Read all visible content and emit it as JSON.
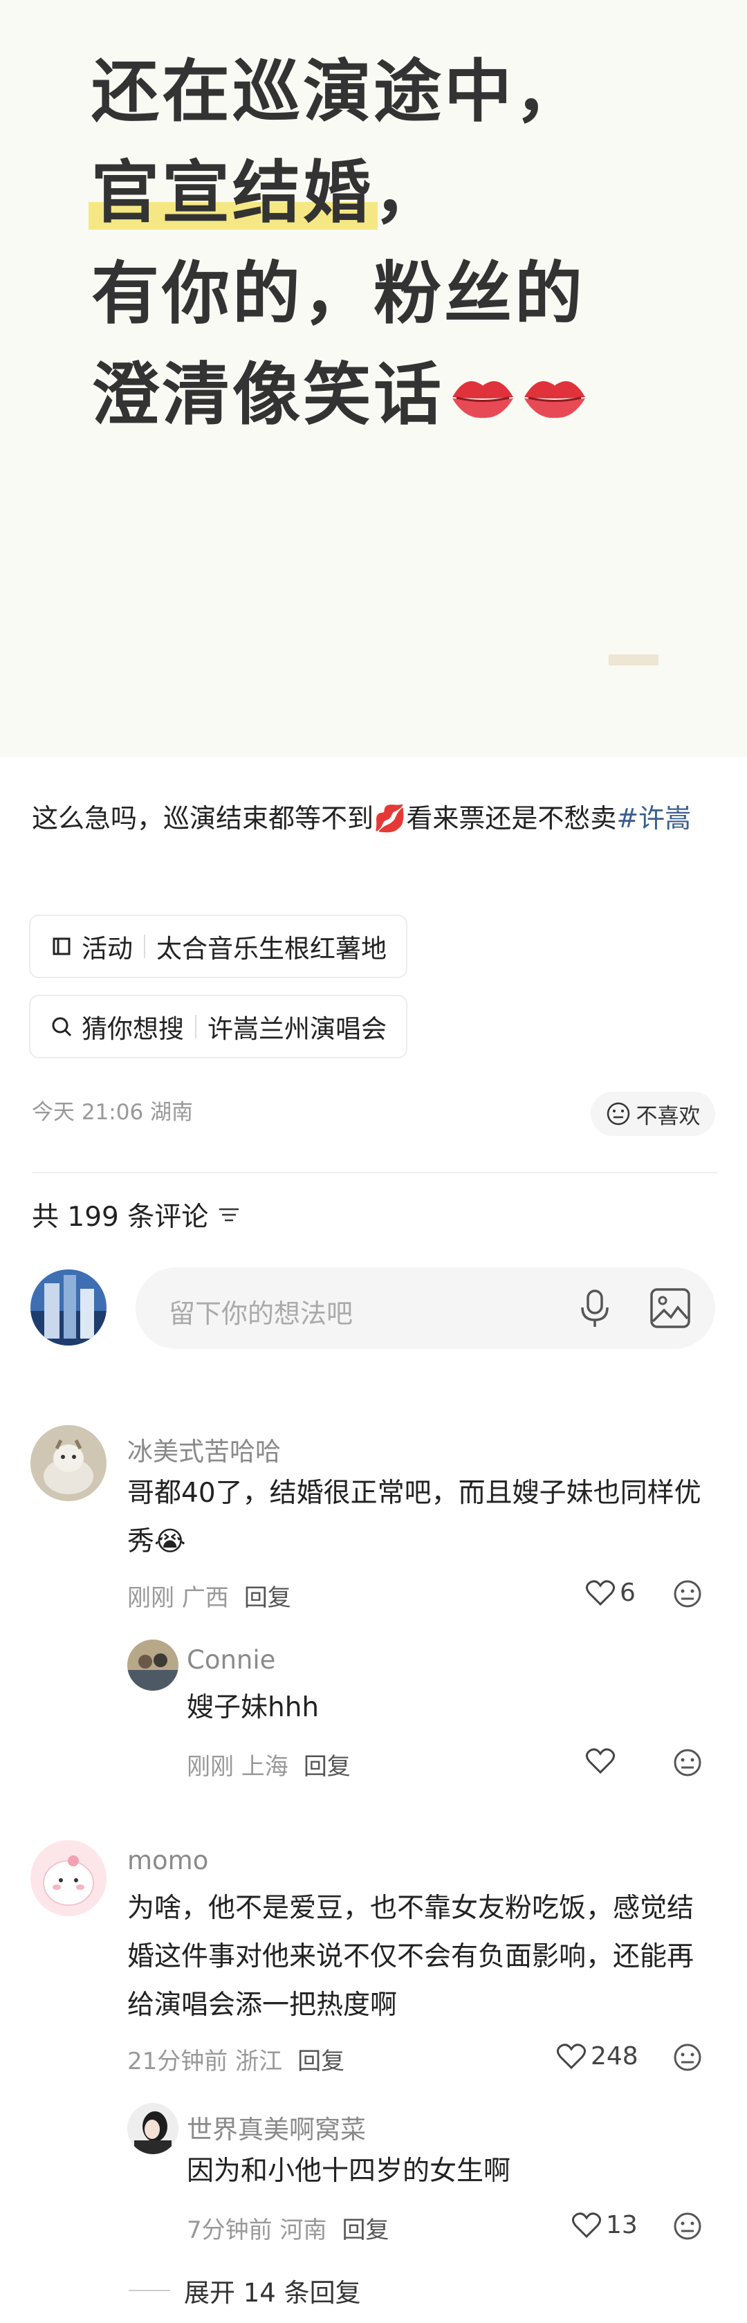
{
  "hero": {
    "line1": "还在巡演途中，",
    "line2_highlight": "官宣结婚",
    "line2_rest": "，",
    "line3": "有你的，粉丝的",
    "line4": "澄清像笑话"
  },
  "post": {
    "text": "这么急吗，巡演结束都等不到💋看来票还是不愁卖",
    "hashtag": "#许嵩",
    "chips": [
      {
        "icon": "activity-icon",
        "type": "活动",
        "label": "太合音乐生根红薯地"
      },
      {
        "icon": "search-icon",
        "type": "猜你想搜",
        "label": "许嵩兰州演唱会"
      }
    ],
    "meta": "今天 21:06 湖南",
    "dislike_label": "不喜欢"
  },
  "comments_header": {
    "count_label": "共 199 条评论",
    "input_placeholder": "留下你的想法吧"
  },
  "comments": [
    {
      "user": "冰美式苦哈哈",
      "text": "哥都40了，结婚很正常吧，而且嫂子妹也同样优秀😭",
      "time_loc": "刚刚 广西",
      "reply_label": "回复",
      "likes": "6",
      "replies": [
        {
          "user": "Connie",
          "text": "嫂子妹hhh",
          "time_loc": "刚刚 上海",
          "reply_label": "回复",
          "likes": ""
        }
      ]
    },
    {
      "user": "momo",
      "text": "为啥，他不是爱豆，也不靠女友粉吃饭，感觉结婚这件事对他来说不仅不会有负面影响，还能再给演唱会添一把热度啊",
      "time_loc": "21分钟前 浙江",
      "reply_label": "回复",
      "likes": "248",
      "replies": [
        {
          "user": "世界真美啊窝菜",
          "text": "因为和小他十四岁的女生啊",
          "time_loc": "7分钟前 河南",
          "reply_label": "回复",
          "likes": "13"
        }
      ],
      "expand_label": "展开 14 条回复"
    }
  ],
  "colors": {
    "highlight": "#f5e884",
    "hashtag": "#3c5e8c",
    "name": "#8a8a8a",
    "meta": "#999999"
  }
}
